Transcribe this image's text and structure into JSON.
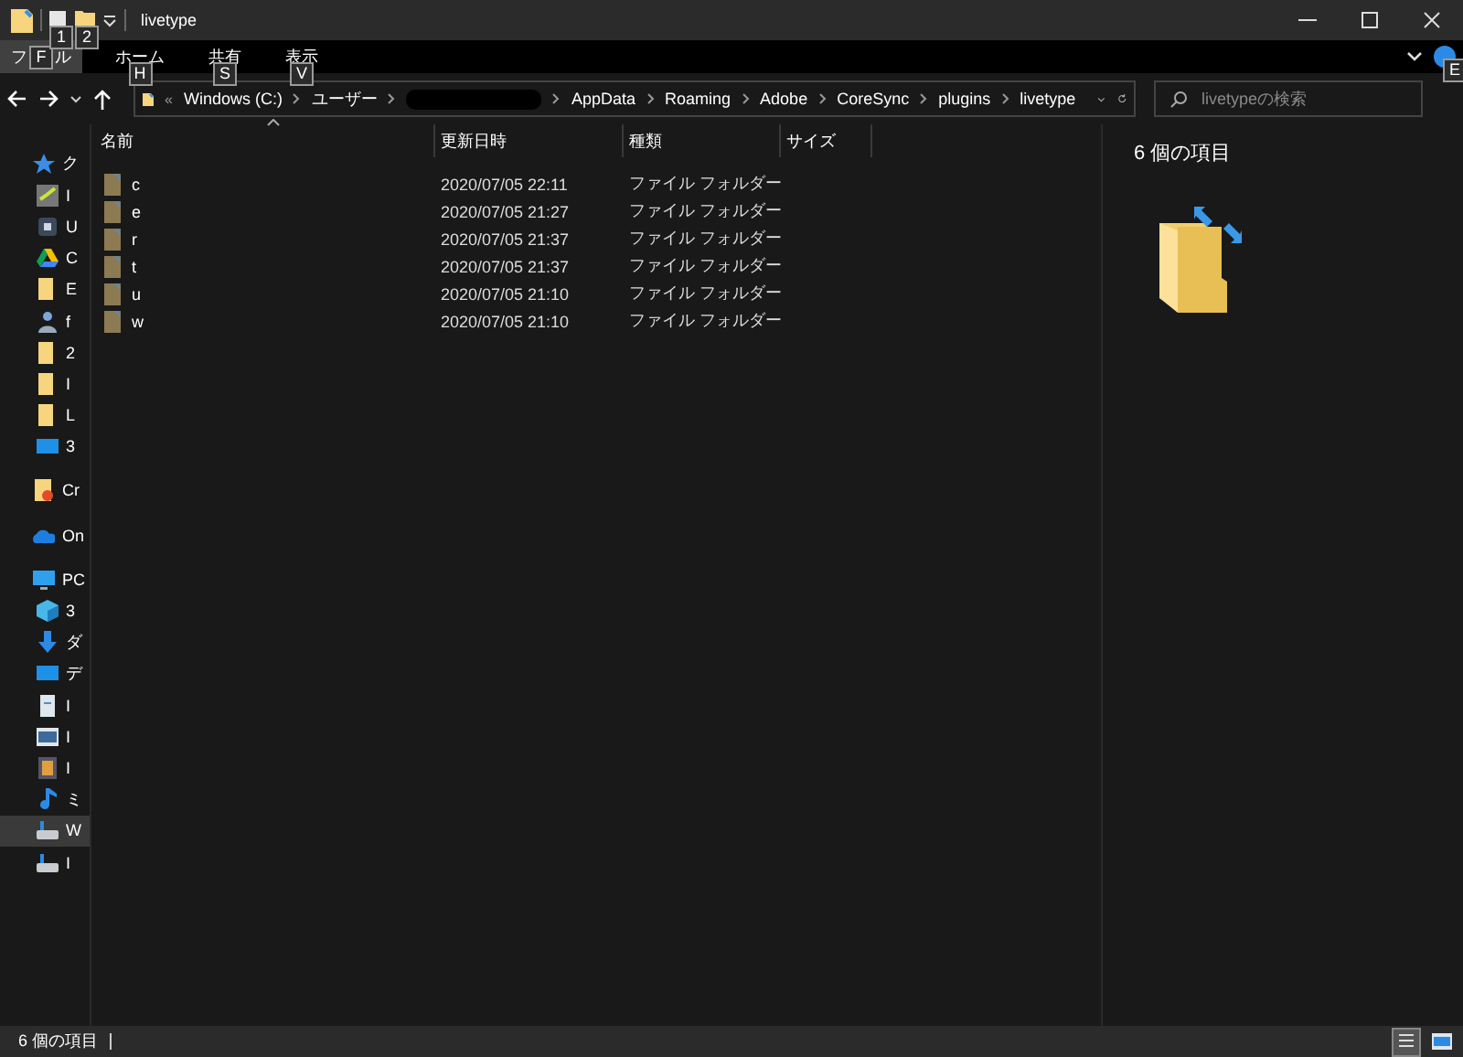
{
  "window": {
    "title": "livetype",
    "quick_access_keys": [
      "1",
      "2"
    ]
  },
  "ribbon": {
    "tabs": [
      {
        "kind": "covered",
        "label_start": "フ",
        "key": "F",
        "label_end": "ル",
        "selected": true
      },
      {
        "kind": "plain",
        "label": "ホーム",
        "key": "H",
        "selected": false
      },
      {
        "kind": "plain",
        "label": "共有",
        "key": "S",
        "selected": false
      },
      {
        "kind": "plain",
        "label": "表示",
        "key": "V",
        "selected": false
      }
    ],
    "help_key": "E"
  },
  "address": {
    "overflow": "«",
    "segments": [
      {
        "kind": "text",
        "label": "Windows (C:)"
      },
      {
        "kind": "text",
        "label": "ユーザー"
      },
      {
        "kind": "redacted"
      },
      {
        "kind": "text",
        "label": "AppData"
      },
      {
        "kind": "text",
        "label": "Roaming"
      },
      {
        "kind": "text",
        "label": "Adobe"
      },
      {
        "kind": "text",
        "label": "CoreSync"
      },
      {
        "kind": "text",
        "label": "plugins"
      },
      {
        "kind": "text",
        "label": "livetype"
      }
    ]
  },
  "search": {
    "placeholder": "livetypeの検索"
  },
  "sidebar": {
    "items": [
      {
        "kind": "star",
        "label": "ク",
        "selected": false
      },
      {
        "kind": "check",
        "label": "I",
        "selected": false
      },
      {
        "kind": "box",
        "label": "U",
        "selected": false
      },
      {
        "kind": "drive",
        "label": "C",
        "selected": false
      },
      {
        "kind": "folder",
        "label": "E",
        "selected": false
      },
      {
        "kind": "people",
        "label": "f",
        "selected": false
      },
      {
        "kind": "folder",
        "label": "2",
        "selected": false
      },
      {
        "kind": "folder",
        "label": "I",
        "selected": false
      },
      {
        "kind": "folder",
        "label": "L",
        "selected": false
      },
      {
        "kind": "screen",
        "label": "3",
        "selected": false
      },
      {
        "kind": "cc",
        "label": "Cr",
        "selected": false
      },
      {
        "kind": "cloud",
        "label": "On",
        "selected": false
      },
      {
        "kind": "pc",
        "label": "PC",
        "selected": false
      },
      {
        "kind": "cube",
        "label": "3",
        "selected": false
      },
      {
        "kind": "down",
        "label": "ダ",
        "selected": false
      },
      {
        "kind": "screen",
        "label": "デ",
        "selected": false
      },
      {
        "kind": "doc",
        "label": "I",
        "selected": false
      },
      {
        "kind": "image",
        "label": "I",
        "selected": false
      },
      {
        "kind": "film",
        "label": "I",
        "selected": false
      },
      {
        "kind": "music",
        "label": "ミ",
        "selected": false
      },
      {
        "kind": "disk",
        "label": "W",
        "selected": true
      },
      {
        "kind": "disk",
        "label": "I",
        "selected": false
      }
    ]
  },
  "table": {
    "columns": [
      {
        "label": "名前",
        "sorted": true
      },
      {
        "label": "更新日時",
        "sorted": false
      },
      {
        "label": "種類",
        "sorted": false
      },
      {
        "label": "サイズ",
        "sorted": false
      }
    ],
    "rows": [
      {
        "name": "c",
        "modified": "2020/07/05 22:11",
        "type": "ファイル フォルダー"
      },
      {
        "name": "e",
        "modified": "2020/07/05 21:27",
        "type": "ファイル フォルダー"
      },
      {
        "name": "r",
        "modified": "2020/07/05 21:37",
        "type": "ファイル フォルダー"
      },
      {
        "name": "t",
        "modified": "2020/07/05 21:37",
        "type": "ファイル フォルダー"
      },
      {
        "name": "u",
        "modified": "2020/07/05 21:10",
        "type": "ファイル フォルダー"
      },
      {
        "name": "w",
        "modified": "2020/07/05 21:10",
        "type": "ファイル フォルダー"
      }
    ]
  },
  "details": {
    "count": "6 個の項目"
  },
  "status_bar": {
    "count": "6 個の項目",
    "views": [
      {
        "kind": "details",
        "selected": true
      },
      {
        "kind": "tiles",
        "selected": false
      }
    ]
  }
}
